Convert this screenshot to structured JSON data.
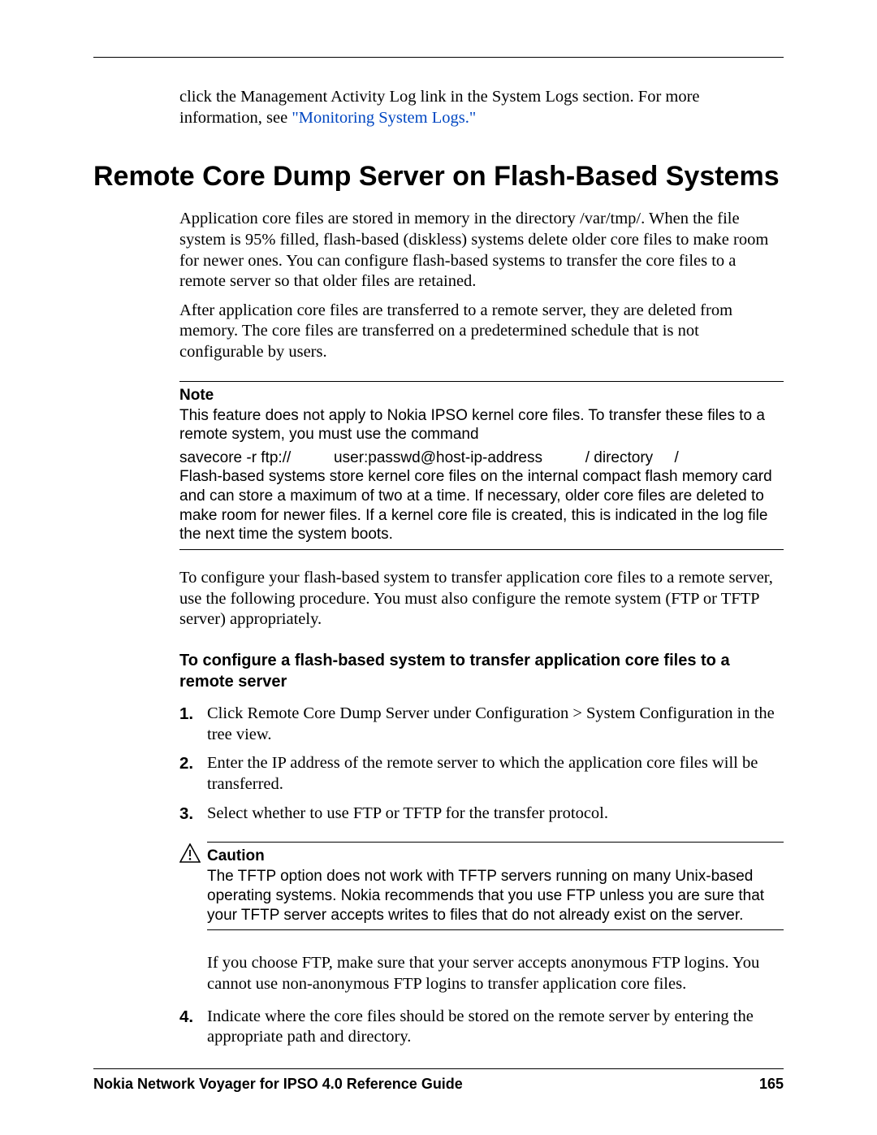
{
  "intro": {
    "line1": "click the Management Activity Log link in the System Logs section. For more information, see ",
    "link_text": "\"Monitoring System Logs.\""
  },
  "heading": "Remote Core Dump Server on Flash-Based Systems",
  "para1": "Application core files are stored in memory in the directory /var/tmp/. When the file system is 95% filled, flash-based (diskless) systems delete older core files to make room for newer ones. You can configure flash-based systems to transfer the core files to a remote server so that older files are retained.",
  "para2": "After application core files are transferred to a remote server, they are deleted from memory. The core files are transferred on a predetermined schedule that is not configurable by users.",
  "note": {
    "label": "Note",
    "body1": "This feature does not apply to Nokia IPSO kernel core files. To transfer these files to a remote system, you must use the command",
    "cmd": "savecore -r ftp://          user:passwd@host-ip-address          / directory     /",
    "body2": "Flash-based systems store kernel core files on the internal compact flash memory card and can store a maximum of two at a time. If necessary, older core files are deleted to make room for newer files. If a kernel core file is created, this is indicated in the log file the next time the system boots."
  },
  "para3": "To configure your flash-based system to transfer application core files to a remote server, use the following procedure. You must also configure the remote system (FTP or TFTP server) appropriately.",
  "sub_heading": "To configure a flash-based system to transfer application core files to a remote server",
  "steps": {
    "n1": "1.",
    "t1": "Click Remote Core Dump Server under Configuration > System Configuration in the tree view.",
    "n2": "2.",
    "t2": "Enter the IP address of the remote server to which the application core files will be transferred.",
    "n3": "3.",
    "t3": "Select whether to use FTP or TFTP for the transfer protocol.",
    "n4": "4.",
    "t4": "Indicate where the core files should be stored on the remote server by entering the appropriate path and directory."
  },
  "caution": {
    "label": "Caution",
    "body": "The TFTP option does not work with TFTP servers running on many Unix-based operating systems. Nokia recommends that you use FTP unless you are sure that your TFTP server accepts writes to files that do not already exist on the server."
  },
  "after_caution": "If you choose FTP, make sure that your server accepts anonymous FTP logins. You cannot use non-anonymous FTP logins to transfer application core files.",
  "footer": {
    "title": "Nokia Network Voyager for IPSO 4.0 Reference Guide",
    "page": "165"
  }
}
